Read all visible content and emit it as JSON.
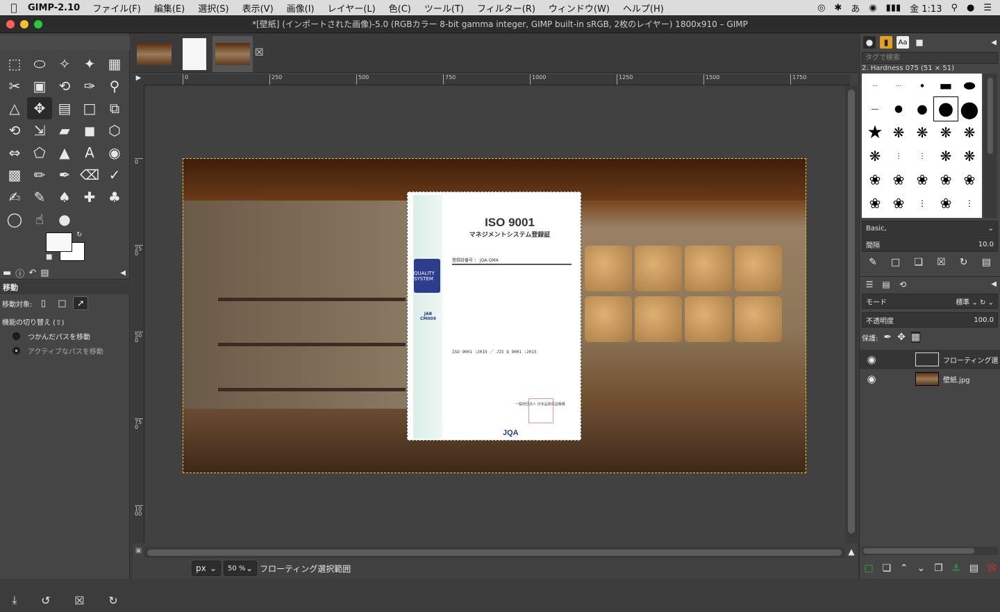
{
  "menubar": {
    "app_name": "GIMP-2.10",
    "items": [
      "ファイル(F)",
      "編集(E)",
      "選択(S)",
      "表示(V)",
      "画像(I)",
      "レイヤー(L)",
      "色(C)",
      "ツール(T)",
      "フィルター(R)",
      "ウィンドウ(W)",
      "ヘルプ(H)"
    ],
    "clock": "金 1:13",
    "input_mode": "あ"
  },
  "window": {
    "title": "*[壁紙] (インポートされた画像)-5.0 (RGBカラー 8-bit gamma integer, GIMP built-in sRGB, 2枚のレイヤー) 1800x910 – GIMP"
  },
  "tool_options": {
    "title": "移動",
    "move_target_label": "移動対象:",
    "toggle_label": "機能の切り替え (⇧)",
    "radio_1": "つかんだパスを移動",
    "radio_2": "アクティブなパスを移動"
  },
  "ruler": {
    "h_labels": [
      "0",
      "250",
      "500",
      "750",
      "1000",
      "1250",
      "1500",
      "1750"
    ],
    "v_labels": [
      "0",
      "250",
      "500",
      "750",
      "1000"
    ]
  },
  "certificate": {
    "title": "ISO 9001",
    "subtitle": "マネジメントシステム登録証",
    "reg_label": "登録証番号 ： JQA-QMA",
    "jab": "JAB",
    "jab_code": "CM009",
    "standard": "ISO 9001 :2015 ／ JIS Q 9001 :2015",
    "issuer": "一般財団法人 日本品質保証機構",
    "logo": "JQA",
    "badge": "QUALITY SYSTEM"
  },
  "statusbar": {
    "unit": "px",
    "zoom": "50 %",
    "message": "フローティング選択範囲"
  },
  "brushes": {
    "search_placeholder": "タグで検索",
    "selected_name": "2. Hardness 075 (51 × 51)",
    "preset": "Basic,",
    "spacing_label": "間隔",
    "spacing_value": "10.0"
  },
  "layers": {
    "mode_label": "モード",
    "mode_value": "標準",
    "opacity_label": "不透明度",
    "opacity_value": "100.0",
    "lock_label": "保護:",
    "items": [
      {
        "name": "フローティング選択範囲 (貼り付けられたレイヤー)"
      },
      {
        "name": "壁紙.jpg"
      }
    ]
  }
}
